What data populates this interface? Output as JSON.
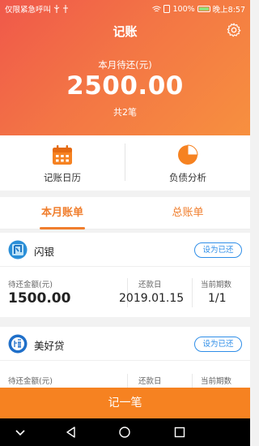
{
  "status_bar": {
    "left_text": "仅限紧急呼叫",
    "battery": "100%",
    "time": "晚上8:57"
  },
  "header": {
    "title": "记账",
    "due_label": "本月待还(元)",
    "due_amount": "2500.00",
    "count": "共2笔"
  },
  "quick_actions": [
    {
      "label": "记账日历",
      "icon": "calendar-icon"
    },
    {
      "label": "负债分析",
      "icon": "pie-chart-icon"
    }
  ],
  "tabs": [
    {
      "label": "本月账单",
      "active": true
    },
    {
      "label": "总账单",
      "active": false
    }
  ],
  "bills": [
    {
      "name": "闪银",
      "action": "设为已还",
      "amount_label": "待还金额(元)",
      "amount": "1500.00",
      "date_label": "还款日",
      "date": "2019.01.15",
      "period_label": "当前期数",
      "period": "1/1"
    },
    {
      "name": "美好贷",
      "action": "设为已还",
      "amount_label": "待还金额(元)",
      "date_label": "还款日",
      "period_label": "当前期数"
    }
  ],
  "bottom_button": "记一笔",
  "colors": {
    "accent": "#f68221",
    "header_start": "#f0584a",
    "link_blue": "#2f8ee8"
  }
}
